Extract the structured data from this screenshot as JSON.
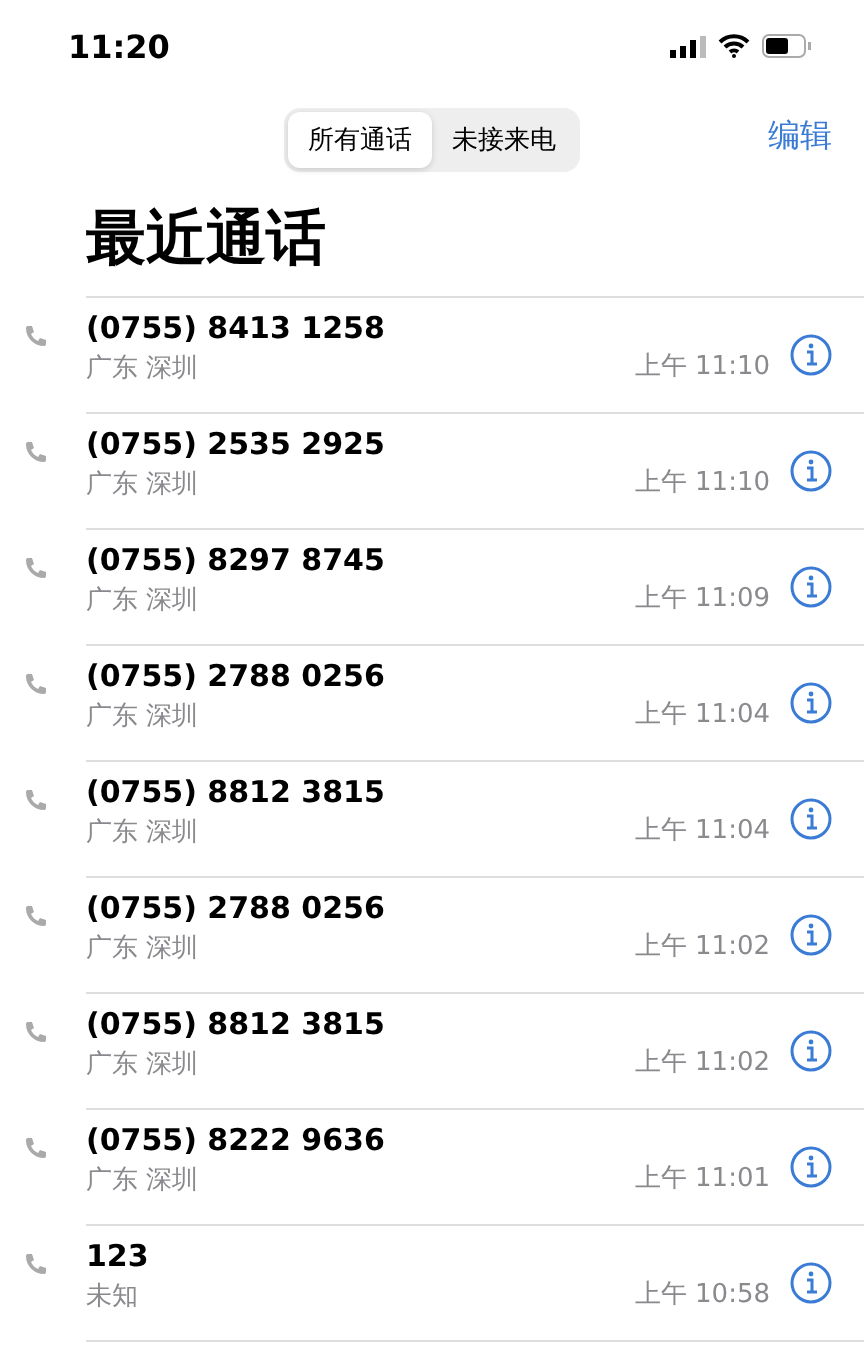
{
  "status_bar": {
    "time": "11:20"
  },
  "segments": [
    {
      "label": "所有通话",
      "selected": true
    },
    {
      "label": "未接来电",
      "selected": false
    }
  ],
  "edit_button": "编辑",
  "title": "最近通话",
  "calls": [
    {
      "number": "(0755) 8413 1258",
      "location": "广东 深圳",
      "time": "上午 11:10"
    },
    {
      "number": "(0755) 2535 2925",
      "location": "广东 深圳",
      "time": "上午 11:10"
    },
    {
      "number": "(0755) 8297 8745",
      "location": "广东 深圳",
      "time": "上午 11:09"
    },
    {
      "number": "(0755) 2788 0256",
      "location": "广东 深圳",
      "time": "上午 11:04"
    },
    {
      "number": "(0755) 8812 3815",
      "location": "广东 深圳",
      "time": "上午 11:04"
    },
    {
      "number": "(0755) 2788 0256",
      "location": "广东 深圳",
      "time": "上午 11:02"
    },
    {
      "number": "(0755) 8812 3815",
      "location": "广东 深圳",
      "time": "上午 11:02"
    },
    {
      "number": "(0755) 8222 9636",
      "location": "广东 深圳",
      "time": "上午 11:01"
    },
    {
      "number": "123",
      "location": "未知",
      "time": "上午 10:58"
    }
  ]
}
